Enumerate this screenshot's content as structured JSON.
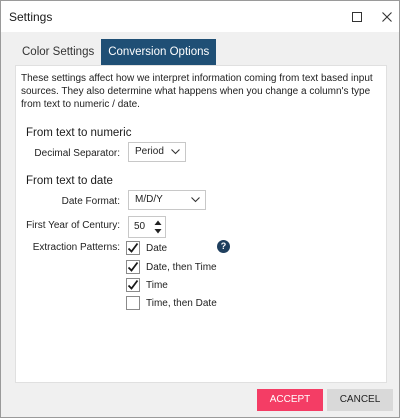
{
  "window": {
    "title": "Settings"
  },
  "tabs": [
    {
      "label": "Color Settings"
    },
    {
      "label": "Conversion Options"
    }
  ],
  "description": "These settings affect how we interpret information coming from text based input sources.  They also determine what happens when you change a column's type from text to numeric / date.",
  "numeric": {
    "heading": "From text to numeric",
    "decimal_label": "Decimal Separator:",
    "decimal_value": "Period"
  },
  "date": {
    "heading": "From text to date",
    "format_label": "Date Format:",
    "format_value": "M/D/Y",
    "century_label": "First Year of Century:",
    "century_value": "50",
    "patterns_label": "Extraction Patterns:",
    "patterns": [
      {
        "label": "Date",
        "checked": true
      },
      {
        "label": "Date, then Time",
        "checked": true
      },
      {
        "label": "Time",
        "checked": true
      },
      {
        "label": "Time, then Date",
        "checked": false
      }
    ],
    "help_glyph": "?"
  },
  "buttons": {
    "accept": "ACCEPT",
    "cancel": "CANCEL"
  },
  "colors": {
    "accent": "#1f4f75",
    "accept": "#f43d65",
    "help": "#1f3f5e"
  },
  "icons": {
    "maximize": "maximize-icon",
    "close": "close-icon",
    "chevron": "chevron-down-icon",
    "check": "checkmark-icon",
    "help": "help-icon"
  }
}
